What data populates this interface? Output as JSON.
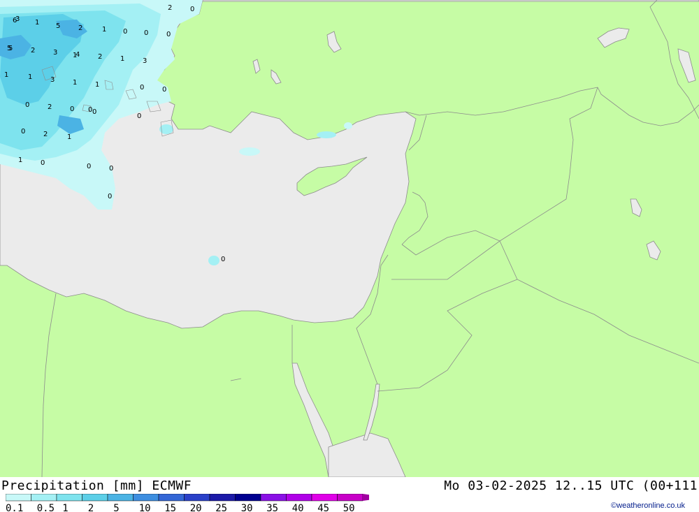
{
  "header": {
    "title": "Precipitation [mm] ECMWF",
    "datetime": "Mo 03-02-2025 12..15 UTC (00+111"
  },
  "copyright": "©weatheronline.co.uk",
  "colors": {
    "land": "#c6fca5",
    "sea": "#ebebeb",
    "border": "#8c8c8c"
  },
  "legend": {
    "ticks": [
      "0.1",
      "0.5",
      "1",
      "2",
      "5",
      "10",
      "15",
      "20",
      "25",
      "30",
      "35",
      "40",
      "45",
      "50"
    ],
    "colors": [
      "#c8f8f8",
      "#a4f0f4",
      "#7ee3ee",
      "#5ccfe8",
      "#4bb3e4",
      "#3d8ee0",
      "#3366d6",
      "#2a40c8",
      "#1c1aa8",
      "#000090",
      "#8a10e6",
      "#b000e8",
      "#e000e8",
      "#c800c8",
      "#a000a0"
    ]
  },
  "map_values": [
    {
      "v": "6"
    },
    {
      "v": "1"
    },
    {
      "v": "5"
    },
    {
      "v": "2"
    },
    {
      "v": "1"
    },
    {
      "v": "0"
    },
    {
      "v": "0"
    },
    {
      "v": "0"
    },
    {
      "v": "5"
    },
    {
      "v": "3"
    },
    {
      "v": "1"
    },
    {
      "v": "0"
    },
    {
      "v": "2"
    },
    {
      "v": "0"
    },
    {
      "v": "5"
    },
    {
      "v": "2"
    },
    {
      "v": "3"
    },
    {
      "v": "4"
    },
    {
      "v": "2"
    },
    {
      "v": "1"
    },
    {
      "v": "3"
    },
    {
      "v": "1"
    },
    {
      "v": "1"
    },
    {
      "v": "3"
    },
    {
      "v": "1"
    },
    {
      "v": "1"
    },
    {
      "v": "0"
    },
    {
      "v": "0"
    },
    {
      "v": "0"
    },
    {
      "v": "2"
    },
    {
      "v": "0"
    },
    {
      "v": "0"
    },
    {
      "v": "0"
    },
    {
      "v": "0"
    },
    {
      "v": "2"
    },
    {
      "v": "1"
    },
    {
      "v": "1"
    },
    {
      "v": "0"
    },
    {
      "v": "0"
    },
    {
      "v": "0"
    },
    {
      "v": "0"
    },
    {
      "v": "0"
    }
  ]
}
